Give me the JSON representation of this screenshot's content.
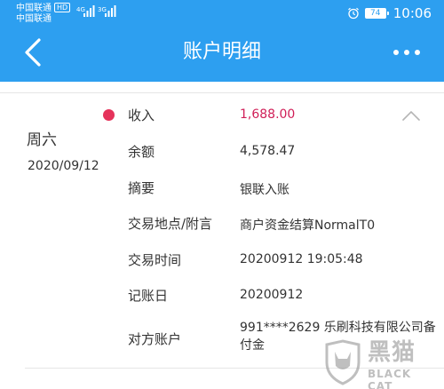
{
  "status_bar": {
    "carrier_1": "中国联通",
    "carrier_1_badge": "HD",
    "carrier_2": "中国联通",
    "network_1": "4G",
    "network_2": "3G",
    "battery_level": "74",
    "time": "10:06"
  },
  "app_bar": {
    "title": "账户明细",
    "back_icon": "chevron-left-icon",
    "more_icon": "more-dots-icon"
  },
  "transaction": {
    "weekday": "周六",
    "date": "2020/09/12",
    "type_color": "#e5335b",
    "rows": [
      {
        "label": "收入",
        "value": "1,688.00"
      },
      {
        "label": "余额",
        "value": "4,578.47"
      },
      {
        "label": "摘要",
        "value": "银联入账"
      },
      {
        "label": "交易地点/附言",
        "value": "商户资金结算NormalT0"
      },
      {
        "label": "交易时间",
        "value": "20200912 19:05:48"
      },
      {
        "label": "记账日",
        "value": "20200912"
      },
      {
        "label": "对方账户",
        "value": "991****2629 乐刷科技有限公司备付金"
      }
    ],
    "collapse_icon": "chevron-up-icon"
  },
  "watermark": {
    "cn": "黑猫",
    "en": "BLACK CAT"
  },
  "colors": {
    "app_bar": "#2d9ff0",
    "income_value": "#d01e57",
    "dot": "#e5335b"
  }
}
